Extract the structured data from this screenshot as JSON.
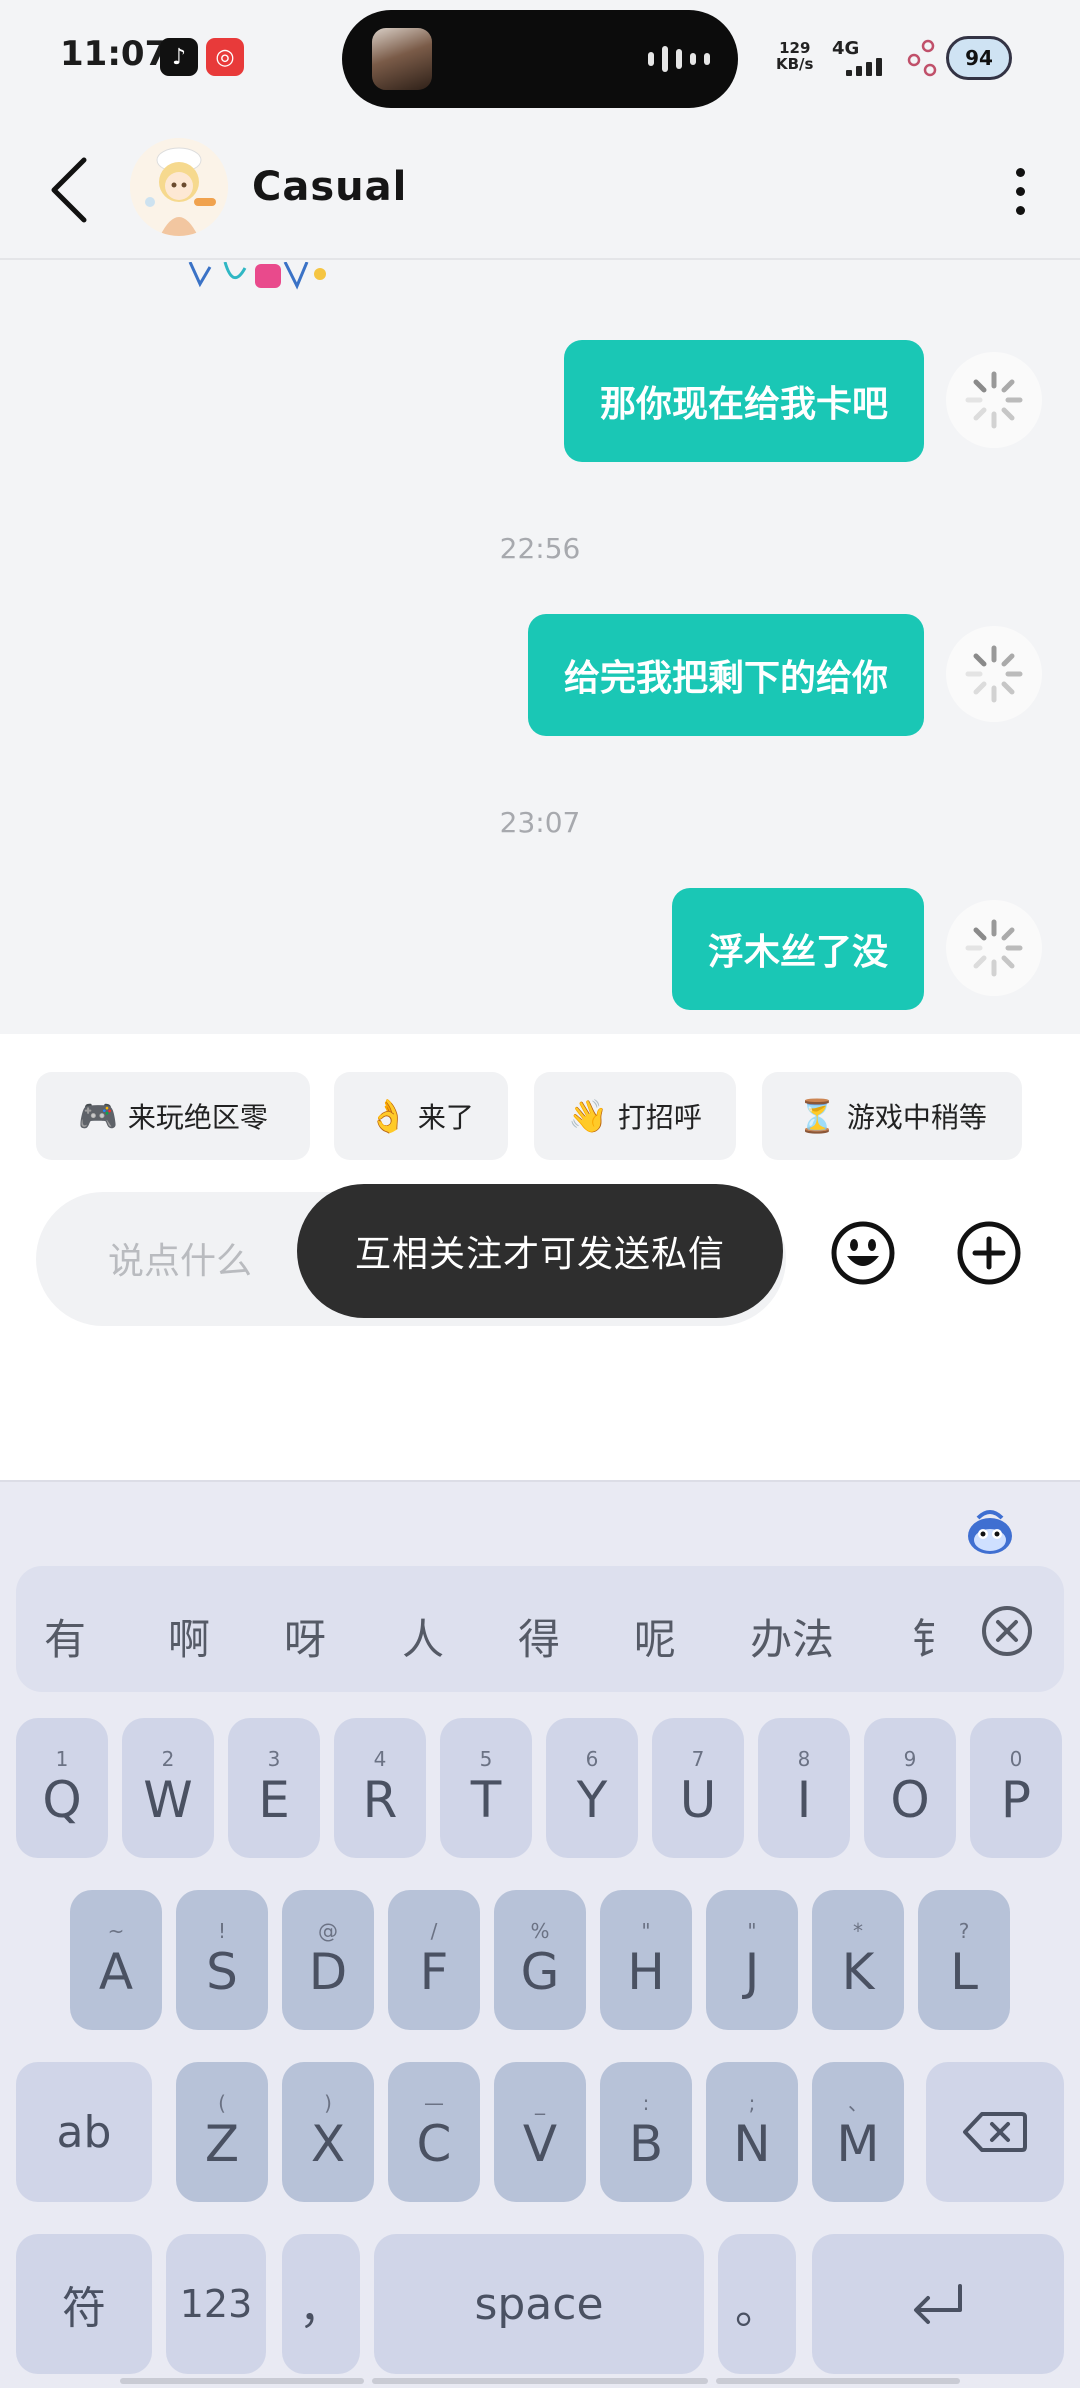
{
  "status_bar": {
    "time": "11:07",
    "tiktok_badge": "♪",
    "music_badge": "◎",
    "net_speed_value": "129",
    "net_speed_unit": "KB/s",
    "network_type": "4G",
    "battery_level": "94"
  },
  "header": {
    "contact_name": "Casual"
  },
  "chat": {
    "messages": [
      {
        "text": "那你现在给我卡吧",
        "sending": true
      },
      {
        "timestamp": "22:56"
      },
      {
        "text": "给完我把剩下的给你",
        "sending": true
      },
      {
        "timestamp": "23:07"
      },
      {
        "text": "浮木丝了没",
        "sending": true
      }
    ]
  },
  "quick_replies": [
    {
      "emoji": "🎮",
      "label": "来玩绝区零"
    },
    {
      "emoji": "👌",
      "label": "来了"
    },
    {
      "emoji": "👋",
      "label": "打招呼"
    },
    {
      "emoji": "⏳",
      "label": "游戏中稍等"
    }
  ],
  "composer": {
    "placeholder": "说点什么",
    "toast": "互相关注才可发送私信"
  },
  "keyboard": {
    "candidates": [
      "有",
      "啊",
      "呀",
      "人",
      "得",
      "呢",
      "办法",
      "钅"
    ],
    "row1": [
      {
        "hint": "1",
        "key": "Q"
      },
      {
        "hint": "2",
        "key": "W"
      },
      {
        "hint": "3",
        "key": "E"
      },
      {
        "hint": "4",
        "key": "R"
      },
      {
        "hint": "5",
        "key": "T"
      },
      {
        "hint": "6",
        "key": "Y"
      },
      {
        "hint": "7",
        "key": "U"
      },
      {
        "hint": "8",
        "key": "I"
      },
      {
        "hint": "9",
        "key": "O"
      },
      {
        "hint": "0",
        "key": "P"
      }
    ],
    "row2": [
      {
        "hint": "~",
        "key": "A"
      },
      {
        "hint": "!",
        "key": "S"
      },
      {
        "hint": "@",
        "key": "D"
      },
      {
        "hint": "/",
        "key": "F"
      },
      {
        "hint": "%",
        "key": "G"
      },
      {
        "hint": "\"",
        "key": "H"
      },
      {
        "hint": "\"",
        "key": "J"
      },
      {
        "hint": "*",
        "key": "K"
      },
      {
        "hint": "?",
        "key": "L"
      }
    ],
    "row3": [
      {
        "hint": "(",
        "key": "Z"
      },
      {
        "hint": ")",
        "key": "X"
      },
      {
        "hint": "—",
        "key": "C"
      },
      {
        "hint": "_",
        "key": "V"
      },
      {
        "hint": ":",
        "key": "B"
      },
      {
        "hint": ";",
        "key": "N"
      },
      {
        "hint": "、",
        "key": "M"
      }
    ],
    "shift_label": "ab",
    "symbols_label": "符",
    "numbers_label": "123",
    "comma_label": "，",
    "space_label": "space",
    "period_label": "。"
  }
}
